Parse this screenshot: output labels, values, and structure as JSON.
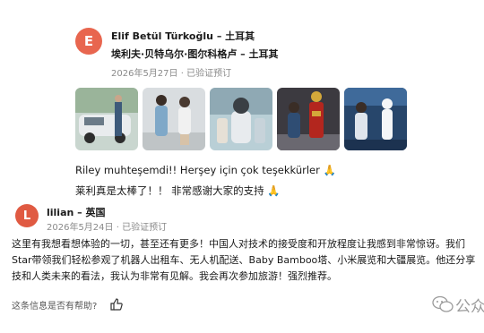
{
  "review1": {
    "avatar_letter": "E",
    "name": "Elif Betül Türkoğlu",
    "separator": " – ",
    "country": "土耳其",
    "translated_name": "埃利夫·贝特乌尔·图尔科格卢 – 土耳其",
    "date": "2026年5月27日 · 已验证预订",
    "quote_original": "Riley muhteşemdi!! Herşey için çok teşekkürler 🙏",
    "quote_translated": "莱利真是太棒了！！ 非常感谢大家的支持 🙏"
  },
  "review2": {
    "avatar_letter": "L",
    "name": "lilian – 英国",
    "date": "2026年5月24日 · 已验证预订",
    "body_lines": [
      "这里有我想看想体验的一切，甚至还有更多！中国人对技术的接受度和开放程度让我感到非常惊讶。我们",
      "Star带领我们轻松参观了机器人出租车、无人机配送、Baby Bamboo塔、小米展览和大疆展览。他还分享",
      "技和人类未来的看法，我认为非常有见解。我会再次参加旅游！强烈推荐。"
    ],
    "helpful_label": "这条信息是否有帮助?"
  },
  "watermark": "公众号",
  "colors": {
    "avatar_e": "#e8664f",
    "avatar_l": "#e05a42",
    "text": "#1a1a1a",
    "muted": "#8a8a8a"
  },
  "icons": [
    "thumbs-up-icon",
    "wechat-icon",
    "pray-emoji"
  ]
}
